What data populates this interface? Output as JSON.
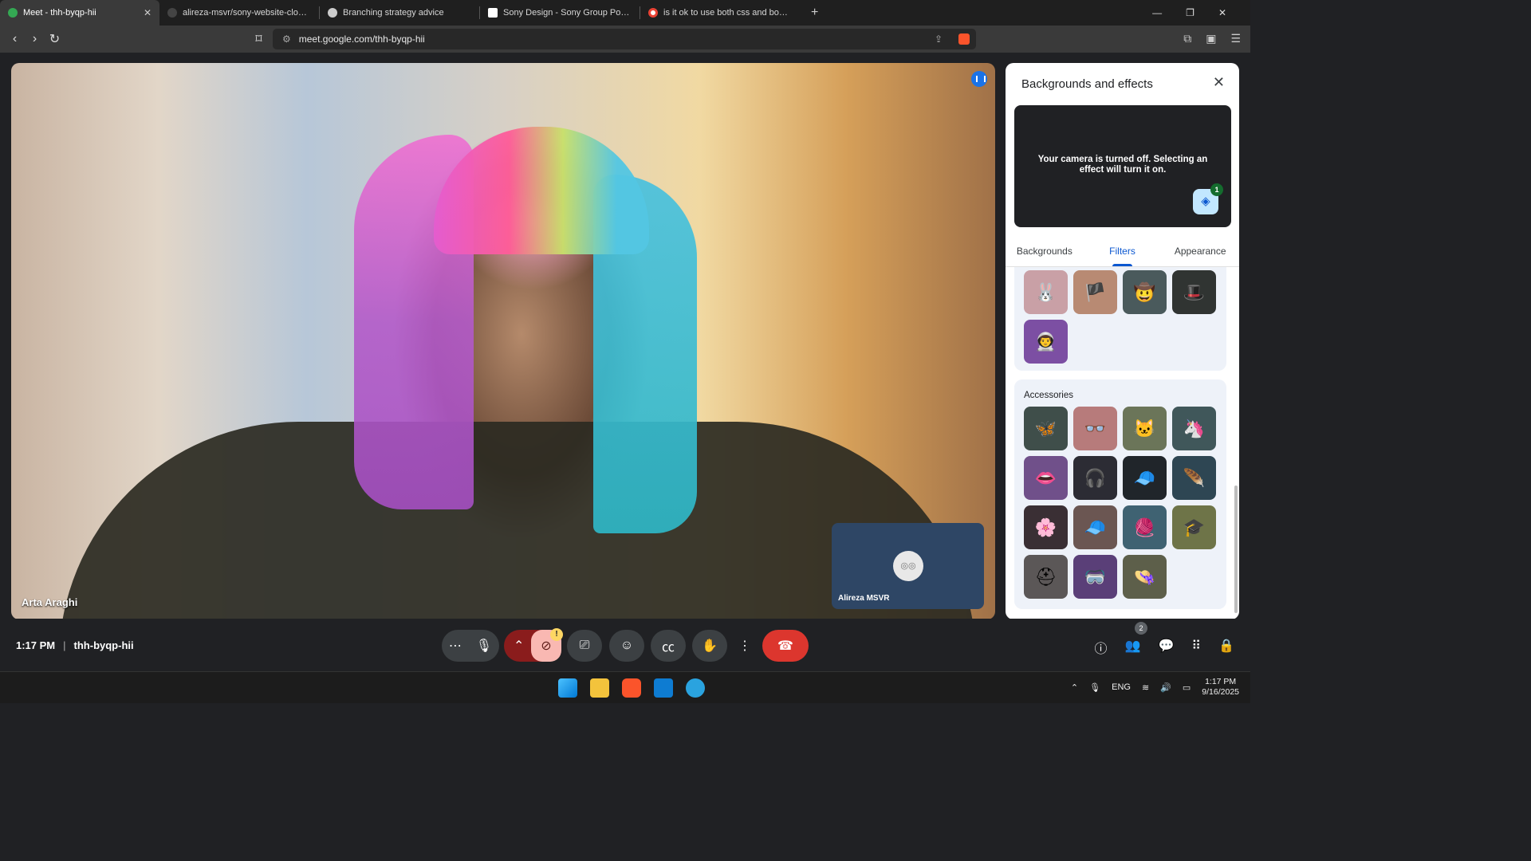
{
  "browser": {
    "tabs": [
      {
        "label": "Meet - thh-byqp-hii",
        "active": true
      },
      {
        "label": "alireza-msvr/sony-website-clone: Co",
        "active": false
      },
      {
        "label": "Branching strategy advice",
        "active": false
      },
      {
        "label": "Sony Design - Sony Group Portal",
        "active": false
      },
      {
        "label": "is it ok to use both css and bootstrap",
        "active": false
      }
    ],
    "url": "meet.google.com/thh-byqp-hii"
  },
  "meeting": {
    "main_participant": "Arta Araghi",
    "self_name": "Alireza MSVR",
    "time": "1:17 PM",
    "code": "thh-byqp-hii",
    "people_count": "2",
    "camera_warning": "!"
  },
  "panel": {
    "title": "Backgrounds and effects",
    "camera_off_text": "Your camera is turned off. Selecting an effect will turn it on.",
    "layers_badge": "1",
    "tabs": [
      "Backgrounds",
      "Filters",
      "Appearance"
    ],
    "active_tab": "Filters",
    "accessories_label": "Accessories",
    "filter_tiles": [
      "bunny-ears-icon",
      "pirate-icon",
      "cowboy-hat-icon",
      "black-hat-icon",
      "astronaut-icon"
    ],
    "accessory_tiles": [
      "butterflies-icon",
      "beret-glasses-icon",
      "cat-ears-glasses-icon",
      "unicorn-headband-icon",
      "face-masks-icon",
      "cat-headphones-icon",
      "cap-icon",
      "feather-icon",
      "cherry-blossom-icon",
      "green-cap-icon",
      "beanie-icon",
      "graduation-cap-icon",
      "hard-hat-icon",
      "visor-glasses-icon",
      "sun-hat-icon"
    ]
  },
  "taskbar": {
    "language": "ENG",
    "time": "1:17 PM",
    "date": "9/16/2025"
  }
}
